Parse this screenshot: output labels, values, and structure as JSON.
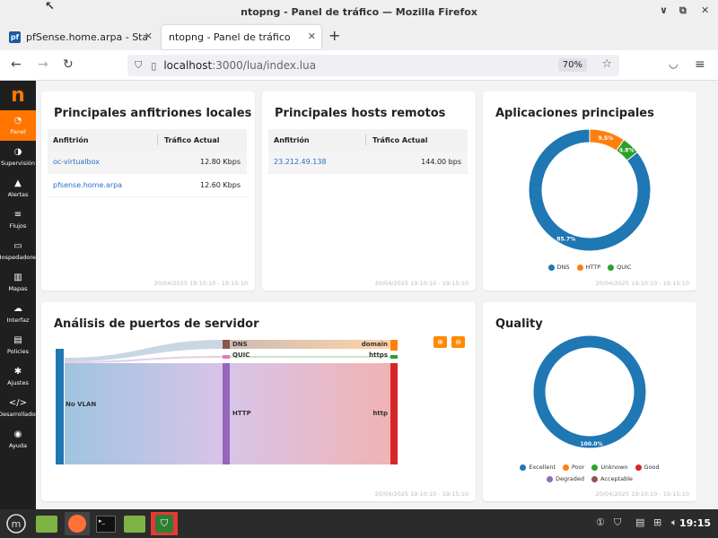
{
  "window": {
    "title": "ntopng - Panel de tráfico — Mozilla Firefox",
    "minimize": "∨",
    "maximize": "⧉",
    "close": "✕"
  },
  "tabs": [
    {
      "label": "pfSense.home.arpa - Status",
      "favicon": "pf"
    },
    {
      "label": "ntopng - Panel de tráfico"
    }
  ],
  "url": {
    "host": "localhost",
    "path": ":3000/lua/index.lua",
    "zoom": "70%"
  },
  "sidebar": {
    "logo": "n",
    "items": [
      {
        "label": "Panel",
        "icon": "◔"
      },
      {
        "label": "Supervisión",
        "icon": "◑"
      },
      {
        "label": "Alertas",
        "icon": "▲"
      },
      {
        "label": "Flujos",
        "icon": "≡"
      },
      {
        "label": "Hospedadores",
        "icon": "▭"
      },
      {
        "label": "Mapas",
        "icon": "▥"
      },
      {
        "label": "Interfaz",
        "icon": "☁"
      },
      {
        "label": "Policies",
        "icon": "▤"
      },
      {
        "label": "Ajustes",
        "icon": "✱"
      },
      {
        "label": "Desarrollador",
        "icon": "</>"
      },
      {
        "label": "Ayuda",
        "icon": "◉"
      }
    ]
  },
  "local_hosts": {
    "title": "Principales anfitriones locales",
    "col_host": "Anfitrión",
    "col_traffic": "Tráfico Actual",
    "rows": [
      {
        "host": "oc-virtualbox",
        "traffic": "12.80 Kbps"
      },
      {
        "host": "pfsense.home.arpa",
        "traffic": "12.60 Kbps"
      }
    ],
    "timestamp": "20/04/2025 19:10:10 - 19:15:10"
  },
  "remote_hosts": {
    "title": "Principales hosts remotos",
    "col_host": "Anfitrión",
    "col_traffic": "Tráfico Actual",
    "rows": [
      {
        "host": "23.212.49.138",
        "traffic": "144.00 bps"
      }
    ],
    "timestamp": "20/04/2025 19:10:10 - 19:15:10"
  },
  "apps": {
    "title": "Aplicaciones principales",
    "timestamp": "20/04/2025 19:10:10 - 19:15:10"
  },
  "ports": {
    "title": "Análisis de puertos de servidor",
    "source": "No VLAN",
    "mid": [
      "DNS",
      "QUIC",
      "HTTP"
    ],
    "targets": [
      "domain",
      "https",
      "http"
    ],
    "timestamp": "20/04/2025 19:10:10 - 19:15:10"
  },
  "quality": {
    "title": "Quality",
    "timestamp": "20/04/2025 19:10:10 - 19:15:10"
  },
  "chart_data": [
    {
      "type": "pie",
      "title": "Aplicaciones principales",
      "categories": [
        "DNS",
        "HTTP",
        "QUIC"
      ],
      "values": [
        85.7,
        9.5,
        4.8
      ],
      "value_labels": [
        "85.7%",
        "9.5%",
        "4.8%"
      ],
      "colors": [
        "#1f77b4",
        "#ff7f0e",
        "#2ca02c"
      ],
      "legend": "bottom"
    },
    {
      "type": "pie",
      "title": "Quality",
      "categories": [
        "Excellent",
        "Poor",
        "Unknown",
        "Good",
        "Degraded",
        "Acceptable"
      ],
      "values": [
        100,
        0,
        0,
        0,
        0,
        0
      ],
      "value_labels": [
        "100.0%"
      ],
      "colors": [
        "#1f77b4",
        "#ff7f0e",
        "#2ca02c",
        "#d62728",
        "#9467bd",
        "#8c564b"
      ],
      "legend": "bottom"
    }
  ],
  "taskbar": {
    "clock": "19:15"
  }
}
